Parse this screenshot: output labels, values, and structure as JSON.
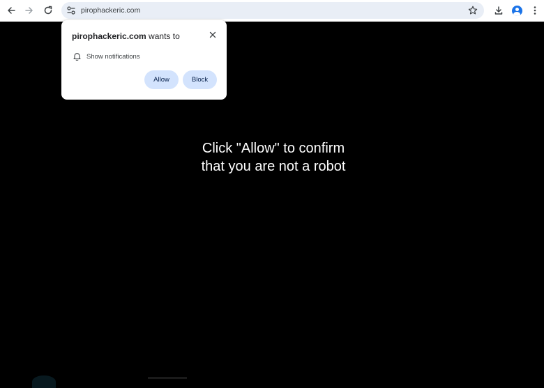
{
  "browser": {
    "url": "pirophackeric.com",
    "icons": {
      "back": "back-arrow-icon",
      "forward": "forward-arrow-icon",
      "reload": "reload-icon",
      "site_info": "tune-icon",
      "bookmark": "star-icon",
      "downloads": "download-icon",
      "profile": "profile-icon",
      "menu": "kebab-menu-icon"
    }
  },
  "permission_popup": {
    "site": "pirophackeric.com",
    "wants_to": " wants to",
    "permission": "Show notifications",
    "allow_label": "Allow",
    "block_label": "Block",
    "icons": {
      "close": "close-icon",
      "permission": "bell-icon"
    }
  },
  "page": {
    "headline_line1": "Click \"Allow\" to confirm",
    "headline_line2": "that you are not a robot"
  },
  "colors": {
    "page_background": "#000000",
    "toolbar_background": "#ffffff",
    "omnibox_background": "#e9eef6",
    "button_background": "#d3e3fd",
    "headline_text": "#ffffff",
    "profile_accent": "#1a73e8"
  }
}
